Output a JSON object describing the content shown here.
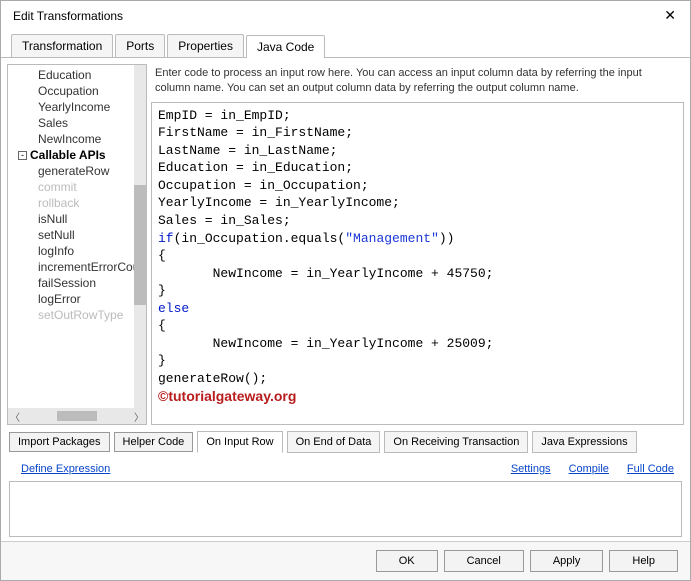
{
  "window": {
    "title": "Edit Transformations"
  },
  "tabsTop": [
    {
      "label": "Transformation"
    },
    {
      "label": "Ports"
    },
    {
      "label": "Properties"
    },
    {
      "label": "Java Code",
      "active": true
    }
  ],
  "tree": {
    "items": [
      {
        "label": "Education"
      },
      {
        "label": "Occupation"
      },
      {
        "label": "YearlyIncome"
      },
      {
        "label": "Sales"
      },
      {
        "label": "NewIncome"
      }
    ],
    "group": "Callable APIs",
    "api": [
      {
        "label": "generateRow"
      },
      {
        "label": "commit",
        "dim": true
      },
      {
        "label": "rollback",
        "dim": true
      },
      {
        "label": "isNull"
      },
      {
        "label": "setNull"
      },
      {
        "label": "logInfo"
      },
      {
        "label": "incrementErrorCount"
      },
      {
        "label": "failSession"
      },
      {
        "label": "logError"
      },
      {
        "label": "setOutRowType",
        "dim": true
      }
    ]
  },
  "instruction": "Enter code to process an input row here. You can access an input column data by referring the input column name. You can set an output column data by referring the output column name.",
  "code": {
    "l1": "EmpID = in_EmpID;",
    "l2": "FirstName = in_FirstName;",
    "l3": "LastName = in_LastName;",
    "l4": "Education = in_Education;",
    "l5": "Occupation = in_Occupation;",
    "l6": "YearlyIncome = in_YearlyIncome;",
    "l7": "Sales = in_Sales;",
    "kw_if": "if",
    "l8a": "(in_Occupation.equals(",
    "l8s": "\"Management\"",
    "l8b": "))",
    "l9": "{",
    "l10": "       NewIncome = in_YearlyIncome + 45750;",
    "l11": "}",
    "kw_else": "else",
    "l13": "{",
    "l14": "       NewIncome = in_YearlyIncome + 25009;",
    "l15": "}",
    "l16": "generateRow();"
  },
  "watermark": "©tutorialgateway.org",
  "midButtons": {
    "import": "Import Packages",
    "helper": "Helper Code"
  },
  "tabsBottom": [
    {
      "label": "On Input Row",
      "active": true
    },
    {
      "label": "On End of Data"
    },
    {
      "label": "On Receiving Transaction"
    },
    {
      "label": "Java Expressions"
    }
  ],
  "links": {
    "define": "Define Expression",
    "settings": "Settings",
    "compile": "Compile",
    "fullcode": "Full Code"
  },
  "footer": {
    "ok": "OK",
    "cancel": "Cancel",
    "apply": "Apply",
    "help": "Help"
  }
}
